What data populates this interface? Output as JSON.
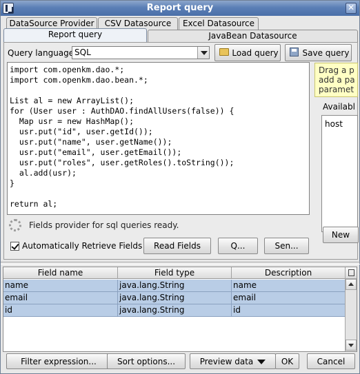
{
  "window": {
    "title": "Report query",
    "close_glyph": "✕"
  },
  "tabs_top": [
    {
      "label": "DataSource Provider"
    },
    {
      "label": "CSV Datasource"
    },
    {
      "label": "Excel Datasource"
    }
  ],
  "tabs_second": [
    {
      "label": "Report query",
      "active": true
    },
    {
      "label": "JavaBean Datasource",
      "active": false
    }
  ],
  "query": {
    "language_label": "Query language",
    "language_value": "SQL",
    "load_button": "Load query",
    "save_button": "Save query",
    "code": "import com.openkm.dao.*;\nimport com.openkm.dao.bean.*;\n\nList al = new ArrayList();\nfor (User user : AuthDAO.findAllUsers(false)) {\n  Map usr = new HashMap();\n  usr.put(\"id\", user.getId());\n  usr.put(\"name\", user.getName());\n  usr.put(\"email\", user.getEmail());\n  usr.put(\"roles\", user.getRoles().toString());\n  al.add(usr);\n}\n\nreturn al;",
    "status_message": "Fields provider for sql queries ready."
  },
  "controls": {
    "auto_retrieve_label": "Automatically Retrieve Fields",
    "auto_retrieve_checked": true,
    "read_fields_button": "Read Fields",
    "q_button": "Q...",
    "sen_button": "Sen..."
  },
  "side_panel": {
    "hint_lines": [
      "Drag a p",
      "add a pa",
      "paramet"
    ],
    "available_label": "Availabl",
    "available_items": [
      "host"
    ],
    "new_button": "New"
  },
  "fields_table": {
    "columns": [
      "Field name",
      "Field type",
      "Description"
    ],
    "rows": [
      {
        "name": "name",
        "type": "java.lang.String",
        "description": "name"
      },
      {
        "name": "email",
        "type": "java.lang.String",
        "description": "email"
      },
      {
        "name": "id",
        "type": "java.lang.String",
        "description": "id"
      }
    ]
  },
  "footer": {
    "filter_button": "Filter expression...",
    "sort_button": "Sort options...",
    "preview_button": "Preview data",
    "ok_button": "OK",
    "cancel_button": "Cancel"
  },
  "colors": {
    "titlebar": "#5b7fb6",
    "row_selected": "#b9cde6",
    "hint_background": "#ffffc4"
  }
}
